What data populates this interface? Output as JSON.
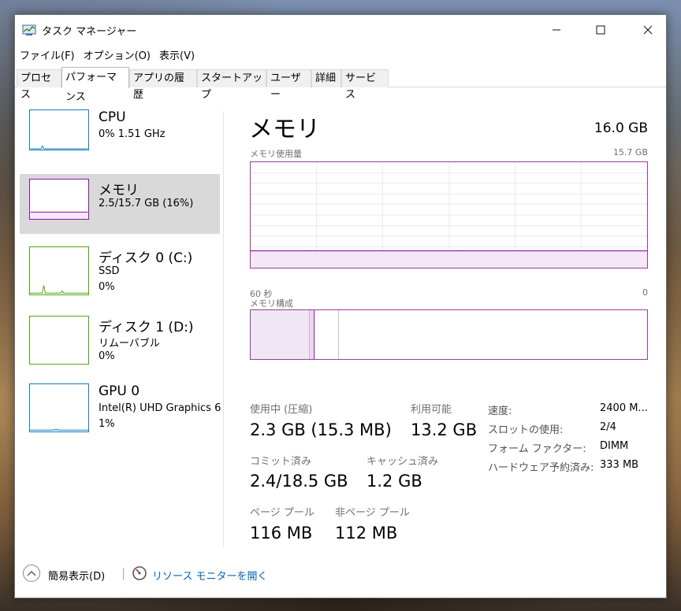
{
  "window": {
    "title": "タスク マネージャー",
    "min_glyph": "—",
    "max_glyph": "☐",
    "close_glyph": "✕"
  },
  "menu": [
    "ファイル(F)",
    "オプション(O)",
    "表示(V)"
  ],
  "tabs": [
    "プロセス",
    "パフォーマンス",
    "アプリの履歴",
    "スタートアップ",
    "ユーザー",
    "詳細",
    "サービス"
  ],
  "active_tab": "パフォーマンス",
  "sidebar": [
    {
      "name": "CPU",
      "line1": "0%  1.51 GHz",
      "line2": "",
      "color": "#117dbb"
    },
    {
      "name": "メモリ",
      "line1": "2.5/15.7 GB (16%)",
      "line2": "",
      "color": "#8b12ae"
    },
    {
      "name": "ディスク 0 (C:)",
      "line1": "SSD",
      "line2": "0%",
      "color": "#4da60c"
    },
    {
      "name": "ディスク 1 (D:)",
      "line1": "リムーバブル",
      "line2": "0%",
      "color": "#4da60c"
    },
    {
      "name": "GPU 0",
      "line1": "Intel(R) UHD Graphics 6",
      "line2": "1%",
      "color": "#117dbb"
    }
  ],
  "main": {
    "title": "メモリ",
    "total": "16.0 GB",
    "usage_label": "メモリ使用量",
    "usage_max": "15.7 GB",
    "axis_left": "60 秒",
    "axis_right": "0",
    "composition_label": "メモリ構成",
    "usage_fraction": 0.16
  },
  "stats": {
    "in_use_label": "使用中 (圧縮)",
    "in_use_value": "2.3 GB (15.3 MB)",
    "available_label": "利用可能",
    "available_value": "13.2 GB",
    "committed_label": "コミット済み",
    "committed_value": "2.4/18.5 GB",
    "cached_label": "キャッシュ済み",
    "cached_value": "1.2 GB",
    "paged_label": "ページ プール",
    "paged_value": "116 MB",
    "nonpaged_label": "非ページ プール",
    "nonpaged_value": "112 MB"
  },
  "details": {
    "speed_label": "速度:",
    "speed_value": "2400 M...",
    "slots_label": "スロットの使用:",
    "slots_value": "2/4",
    "form_label": "フォーム ファクター:",
    "form_value": "DIMM",
    "reserved_label": "ハードウェア予約済み:",
    "reserved_value": "333 MB"
  },
  "footer": {
    "summary": "簡易表示(D)",
    "resmon": "リソース モニターを開く"
  }
}
